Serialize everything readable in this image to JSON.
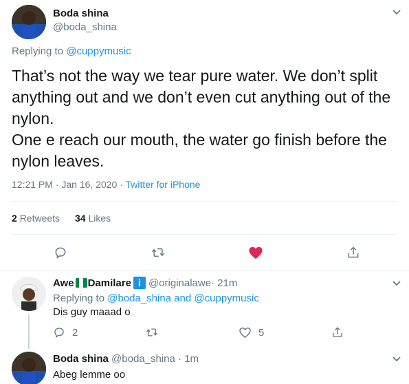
{
  "main_tweet": {
    "author_name": "Boda shina",
    "author_handle": "@boda_shina",
    "replying_to_prefix": "Replying to ",
    "replying_to": "@cuppymusic",
    "text_lines": [
      "That’s not the way we tear pure water. We don’t split",
      "anything out and we don’t even cut anything out of the",
      "nylon.",
      "One e reach our mouth, the water go finish before the",
      "nylon leaves."
    ],
    "timestamp": "12:21 PM · Jan 16, 2020 · ",
    "source": "Twitter for iPhone",
    "retweets_count": "2",
    "retweets_label": "Retweets",
    "likes_count": "34",
    "likes_label": "Likes"
  },
  "reply1": {
    "author_name_a": "Awe",
    "author_name_b": "Damilare",
    "author_handle": "@originalawe",
    "time": " · 21m",
    "replying_to_prefix": "Replying to ",
    "replying_to_1": "@boda_shina",
    "replying_to_and": " and ",
    "replying_to_2": "@cuppymusic",
    "text": "Dis guy maaad o",
    "reply_count": "2",
    "like_count": "5"
  },
  "reply2": {
    "author_name": "Boda shina",
    "author_handle": "@boda_shina",
    "time": " · 1m",
    "text": "Abeg lemme oo"
  },
  "colors": {
    "link": "#1b95e0",
    "like": "#e0245e",
    "muted": "#657786",
    "flag_green": "#008751",
    "info_blue": "#1b95e0"
  }
}
